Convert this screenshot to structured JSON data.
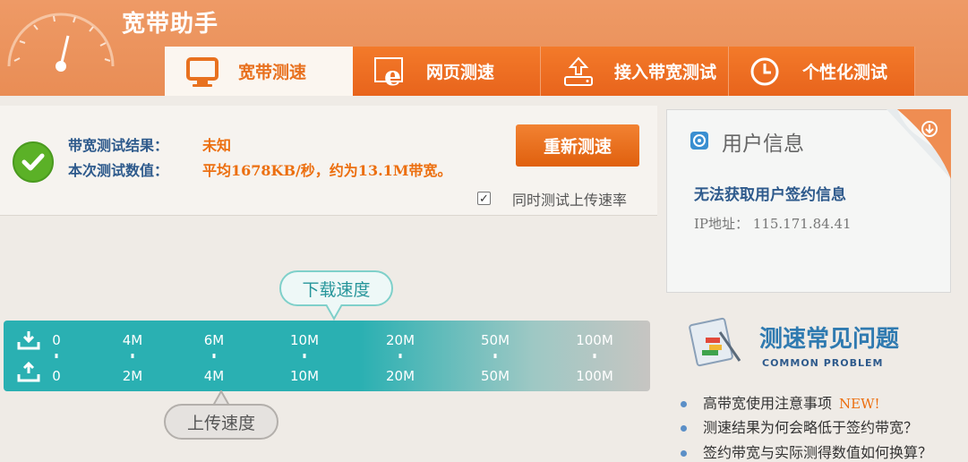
{
  "app": {
    "title": "宽带助手"
  },
  "tabs": [
    {
      "label": "宽带测速",
      "icon": "monitor-icon",
      "active": true
    },
    {
      "label": "网页测速",
      "icon": "ie-browser-icon",
      "active": false
    },
    {
      "label": "接入带宽测试",
      "icon": "router-icon",
      "active": false
    },
    {
      "label": "个性化测试",
      "icon": "clock-icon",
      "active": false
    }
  ],
  "result": {
    "label1": "带宽测试结果：",
    "value1": "未知",
    "label2": "本次测试数值：",
    "value2": "平均1678KB/秒，约为13.1M带宽。"
  },
  "buttons": {
    "retest": "重新测速"
  },
  "upload_option": {
    "label": "同时测试上传速率",
    "checked": true
  },
  "speed_scale": {
    "download_label": "下载速度",
    "upload_label": "上传速度",
    "download_ticks": [
      "0",
      "4M",
      "6M",
      "10M",
      "20M",
      "50M",
      "100M"
    ],
    "upload_ticks": [
      "0",
      "2M",
      "4M",
      "10M",
      "20M",
      "50M",
      "100M"
    ]
  },
  "user_info": {
    "title": "用户信息",
    "message": "无法获取用户签约信息",
    "ip": "IP地址： 115.171.84.41"
  },
  "faq": {
    "title": "测速常见问题",
    "subtitle": "COMMON PROBLEM",
    "items": [
      {
        "text": "高带宽使用注意事项",
        "badge": "NEW!"
      },
      {
        "text": "测速结果为何会略低于签约带宽？",
        "badge": ""
      },
      {
        "text": "签约带宽与实际测得数值如何换算？",
        "badge": ""
      }
    ]
  },
  "colors": {
    "accent": "#e8641c",
    "teal": "#2ab0b2",
    "header": "#ec955f"
  }
}
